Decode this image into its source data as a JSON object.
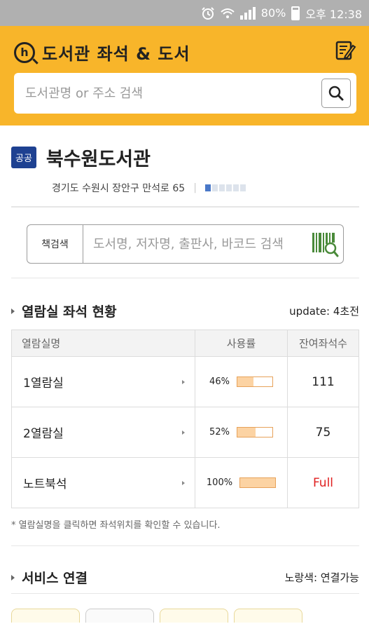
{
  "status_bar": {
    "battery": "80%",
    "ampm": "오후",
    "time": "12:38"
  },
  "header": {
    "title": "도서관 좌석 & 도서",
    "search_placeholder": "도서관명 or 주소 검색"
  },
  "library": {
    "badge": "공공",
    "name": "북수원도서관",
    "address": "경기도 수원시 장안구 만석로 65",
    "rating_level": 1,
    "rating_max": 6
  },
  "book_search": {
    "label": "책검색",
    "placeholder": "도서명, 저자명, 출판사, 바코드 검색"
  },
  "seat_status": {
    "title": "열람실 좌석 현황",
    "update_label": "update: 4초전",
    "columns": [
      "열람실명",
      "사용률",
      "잔여좌석수"
    ],
    "rows": [
      {
        "name": "1열람실",
        "usage": "46%",
        "usage_value": 0.46,
        "remaining": "111"
      },
      {
        "name": "2열람실",
        "usage": "52%",
        "usage_value": 0.52,
        "remaining": "75"
      },
      {
        "name": "노트북석",
        "usage": "100%",
        "usage_value": 1.0,
        "remaining": "Full"
      }
    ],
    "note": "* 열람실명을 클릭하면 좌석위치를 확인할 수 있습니다."
  },
  "service": {
    "title": "서비스 연결",
    "legend": "노랑색: 연결가능"
  },
  "colors": {
    "header_bg": "#f8b52a",
    "badge_bg": "#1e4191",
    "full_text": "#e02020",
    "bar_fill": "#fcd3a3"
  }
}
